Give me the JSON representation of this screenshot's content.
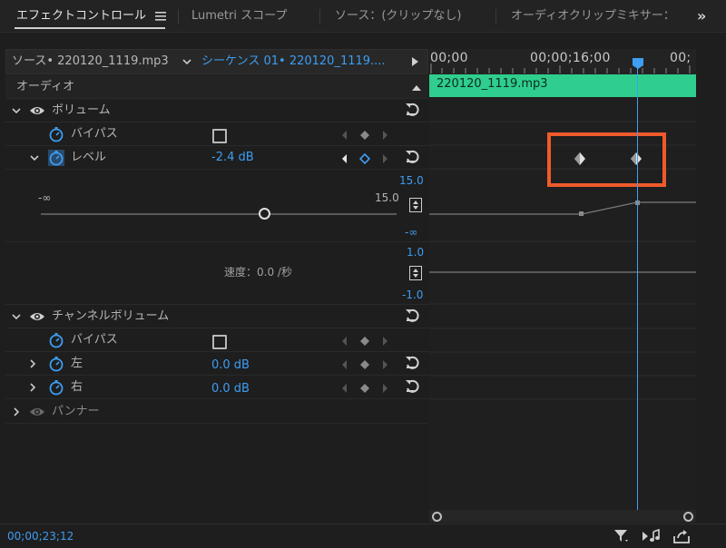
{
  "tabs": [
    {
      "label": "エフェクトコントロール",
      "active": true
    },
    {
      "label": "Lumetri スコープ",
      "active": false
    },
    {
      "label": "ソース：(クリップなし)",
      "active": false
    },
    {
      "label": "オーディオクリップミキサー：",
      "active": false
    }
  ],
  "tab_overflow": "»",
  "source_bar": {
    "source_label": "ソース• 220120_1119.mp3",
    "sequence_label": "シーケンス 01• 220120_1119...."
  },
  "ruler": {
    "labels": [
      "00;00",
      "00;00;16;00",
      "00;"
    ]
  },
  "clip_name": "220120_1119.mp3",
  "section_audio": "オーディオ",
  "volume": {
    "title": "ボリューム",
    "bypass_label": "バイパス",
    "level_label": "レベル",
    "level_value": "-2.4 dB",
    "graph_top": "15.0",
    "graph_bottom": "-∞",
    "slider_min": "-∞",
    "slider_max": "15.0",
    "slider_fraction": 0.63,
    "speed_top": "1.0",
    "speed_label": "速度：0.0 /秒",
    "speed_bottom": "-1.0"
  },
  "channel_volume": {
    "title": "チャンネルボリューム",
    "bypass_label": "バイパス",
    "left_label": "左",
    "left_value": "0.0 dB",
    "right_label": "右",
    "right_value": "0.0 dB"
  },
  "panner": {
    "title": "パンナー"
  },
  "timecode": "00;00;23;12",
  "colors": {
    "accent_blue": "#3d9df2",
    "clip_green": "#2fce8e",
    "highlight": "#f05a2b"
  }
}
